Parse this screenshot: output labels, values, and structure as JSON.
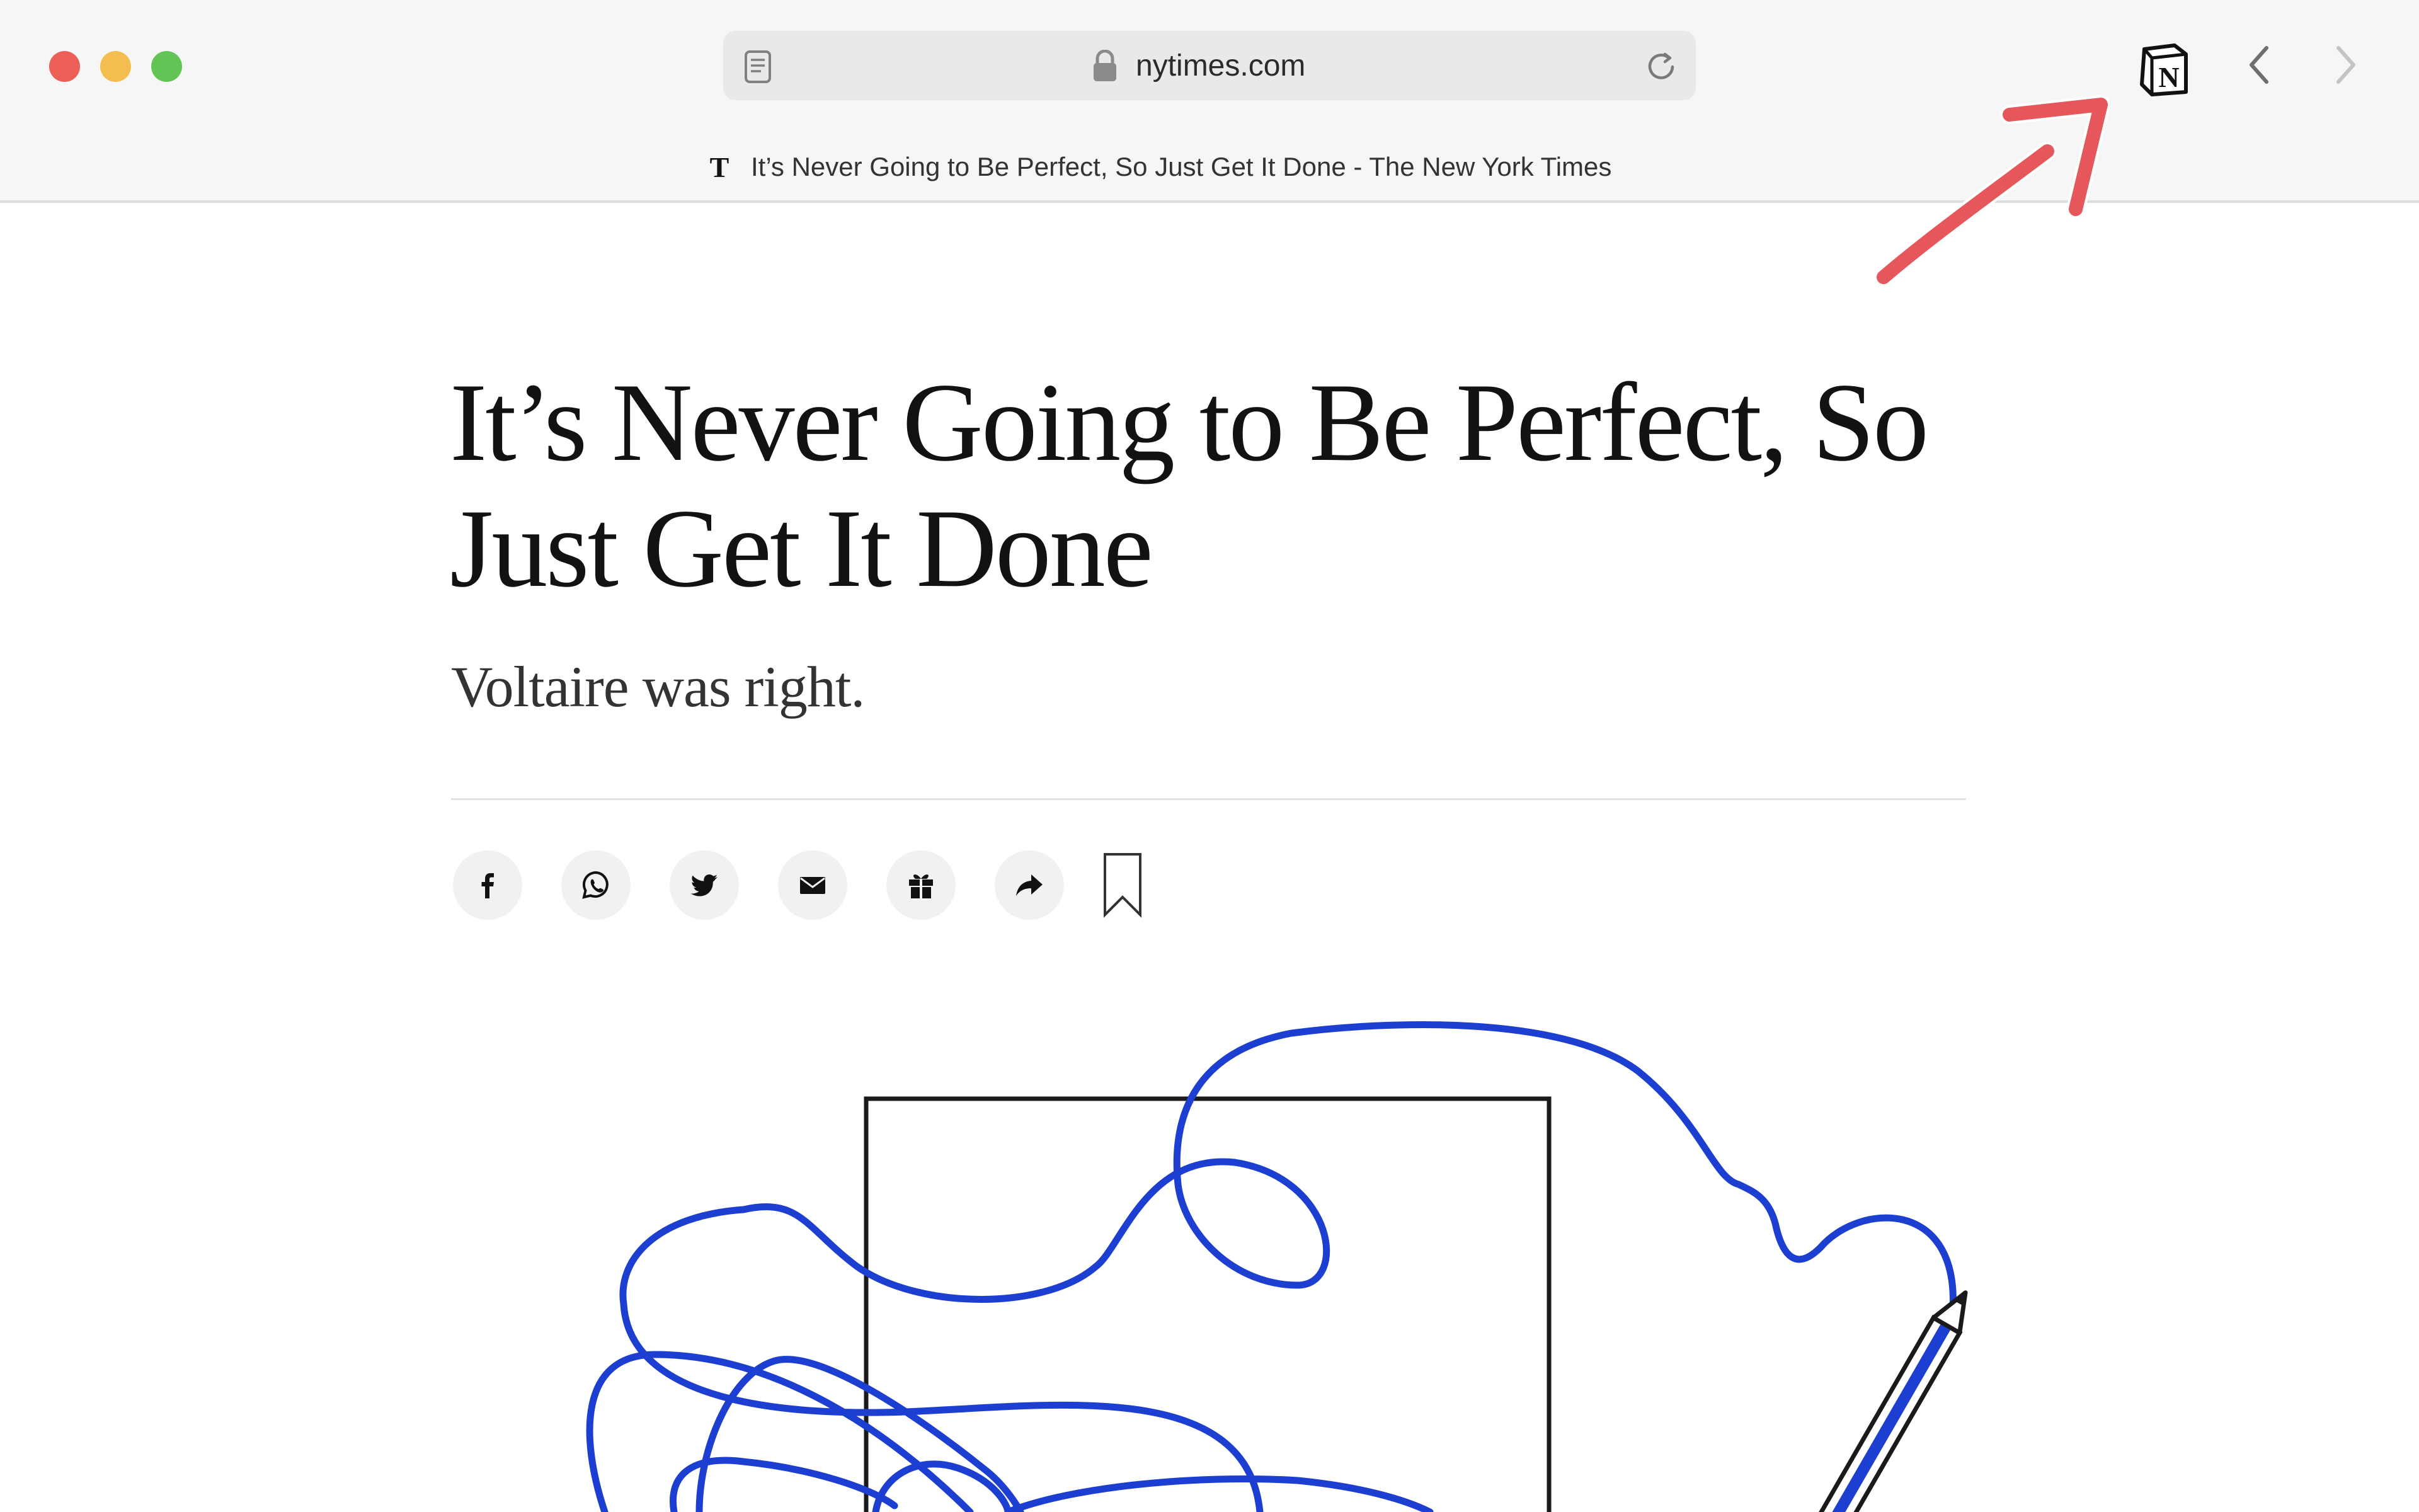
{
  "browser": {
    "url": "nytimes.com",
    "tab_title": "It’s Never Going to Be Perfect, So Just Get It Done - The New York Times"
  },
  "article": {
    "headline": "It’s Never Going to Be Perfect, So Just Get It Done",
    "subheadline": "Voltaire was right."
  },
  "share_icons": [
    "facebook-icon",
    "whatsapp-icon",
    "twitter-icon",
    "email-icon",
    "gift-icon",
    "share-arrow-icon",
    "bookmark-icon"
  ],
  "colors": {
    "annotation_arrow": "#e5575a",
    "scribble": "#1d3fd1",
    "close": "#ec5f57",
    "minimize": "#f4bd4f",
    "maximize": "#61c454"
  }
}
